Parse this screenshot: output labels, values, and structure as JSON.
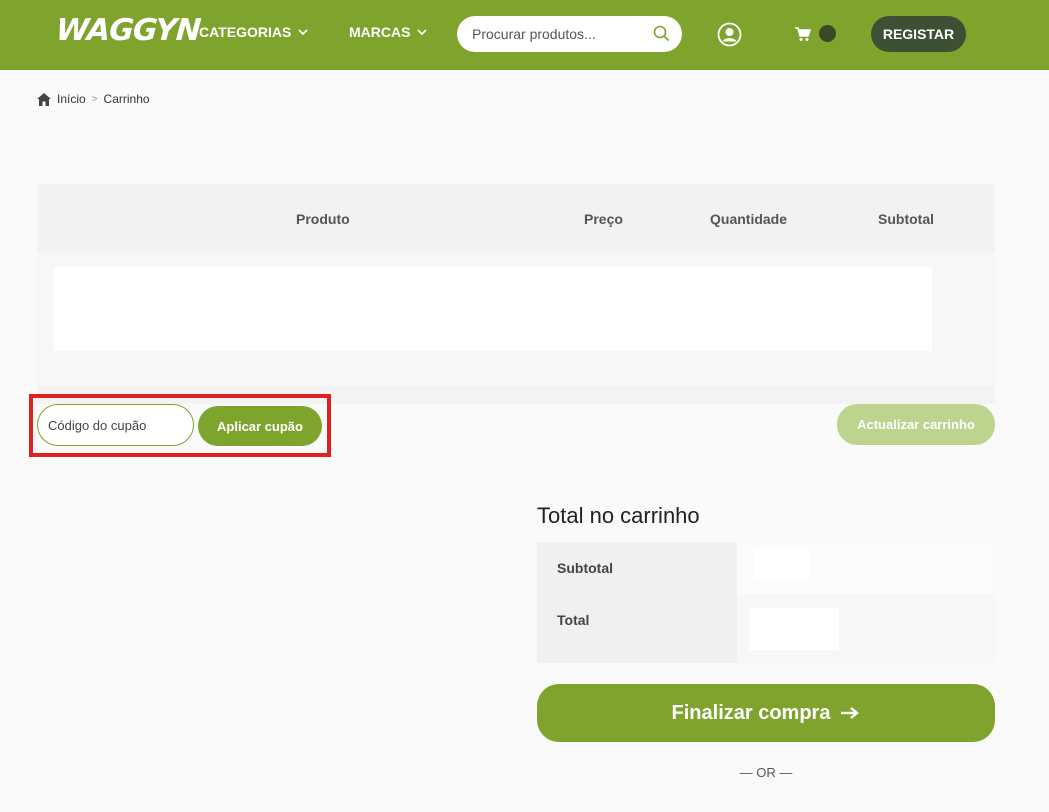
{
  "header": {
    "logo": "WAGGYN",
    "nav": [
      {
        "label": "CATEGORIAS",
        "icon": "chevron-down-icon"
      },
      {
        "label": "MARCAS",
        "icon": "chevron-down-icon"
      }
    ],
    "search": {
      "placeholder": "Procurar produtos...",
      "value": "",
      "icon": "search-icon"
    },
    "user_icon": "user-circle-icon",
    "cart_icon": "cart-icon",
    "register_label": "REGISTAR"
  },
  "breadcrumb": {
    "items": [
      "Início",
      "Carrinho"
    ],
    "separator": ">"
  },
  "cart_table": {
    "columns": [
      "Produto",
      "Preço",
      "Quantidade",
      "Subtotal"
    ]
  },
  "coupon": {
    "placeholder": "Código do cupão",
    "value": "",
    "apply_label": "Aplicar cupão"
  },
  "update_cart_label": "Actualizar carrinho",
  "totals": {
    "title": "Total no carrinho",
    "rows": [
      {
        "label": "Subtotal",
        "value": ""
      },
      {
        "label": "Total",
        "value": ""
      }
    ]
  },
  "checkout_label": "Finalizar compra",
  "or_separator": "— OR —",
  "colors": {
    "brand_green": "#7ea42e",
    "dark_green": "#3e5033",
    "highlight_red": "#e02121",
    "disabled_green": "#bcd48e"
  }
}
